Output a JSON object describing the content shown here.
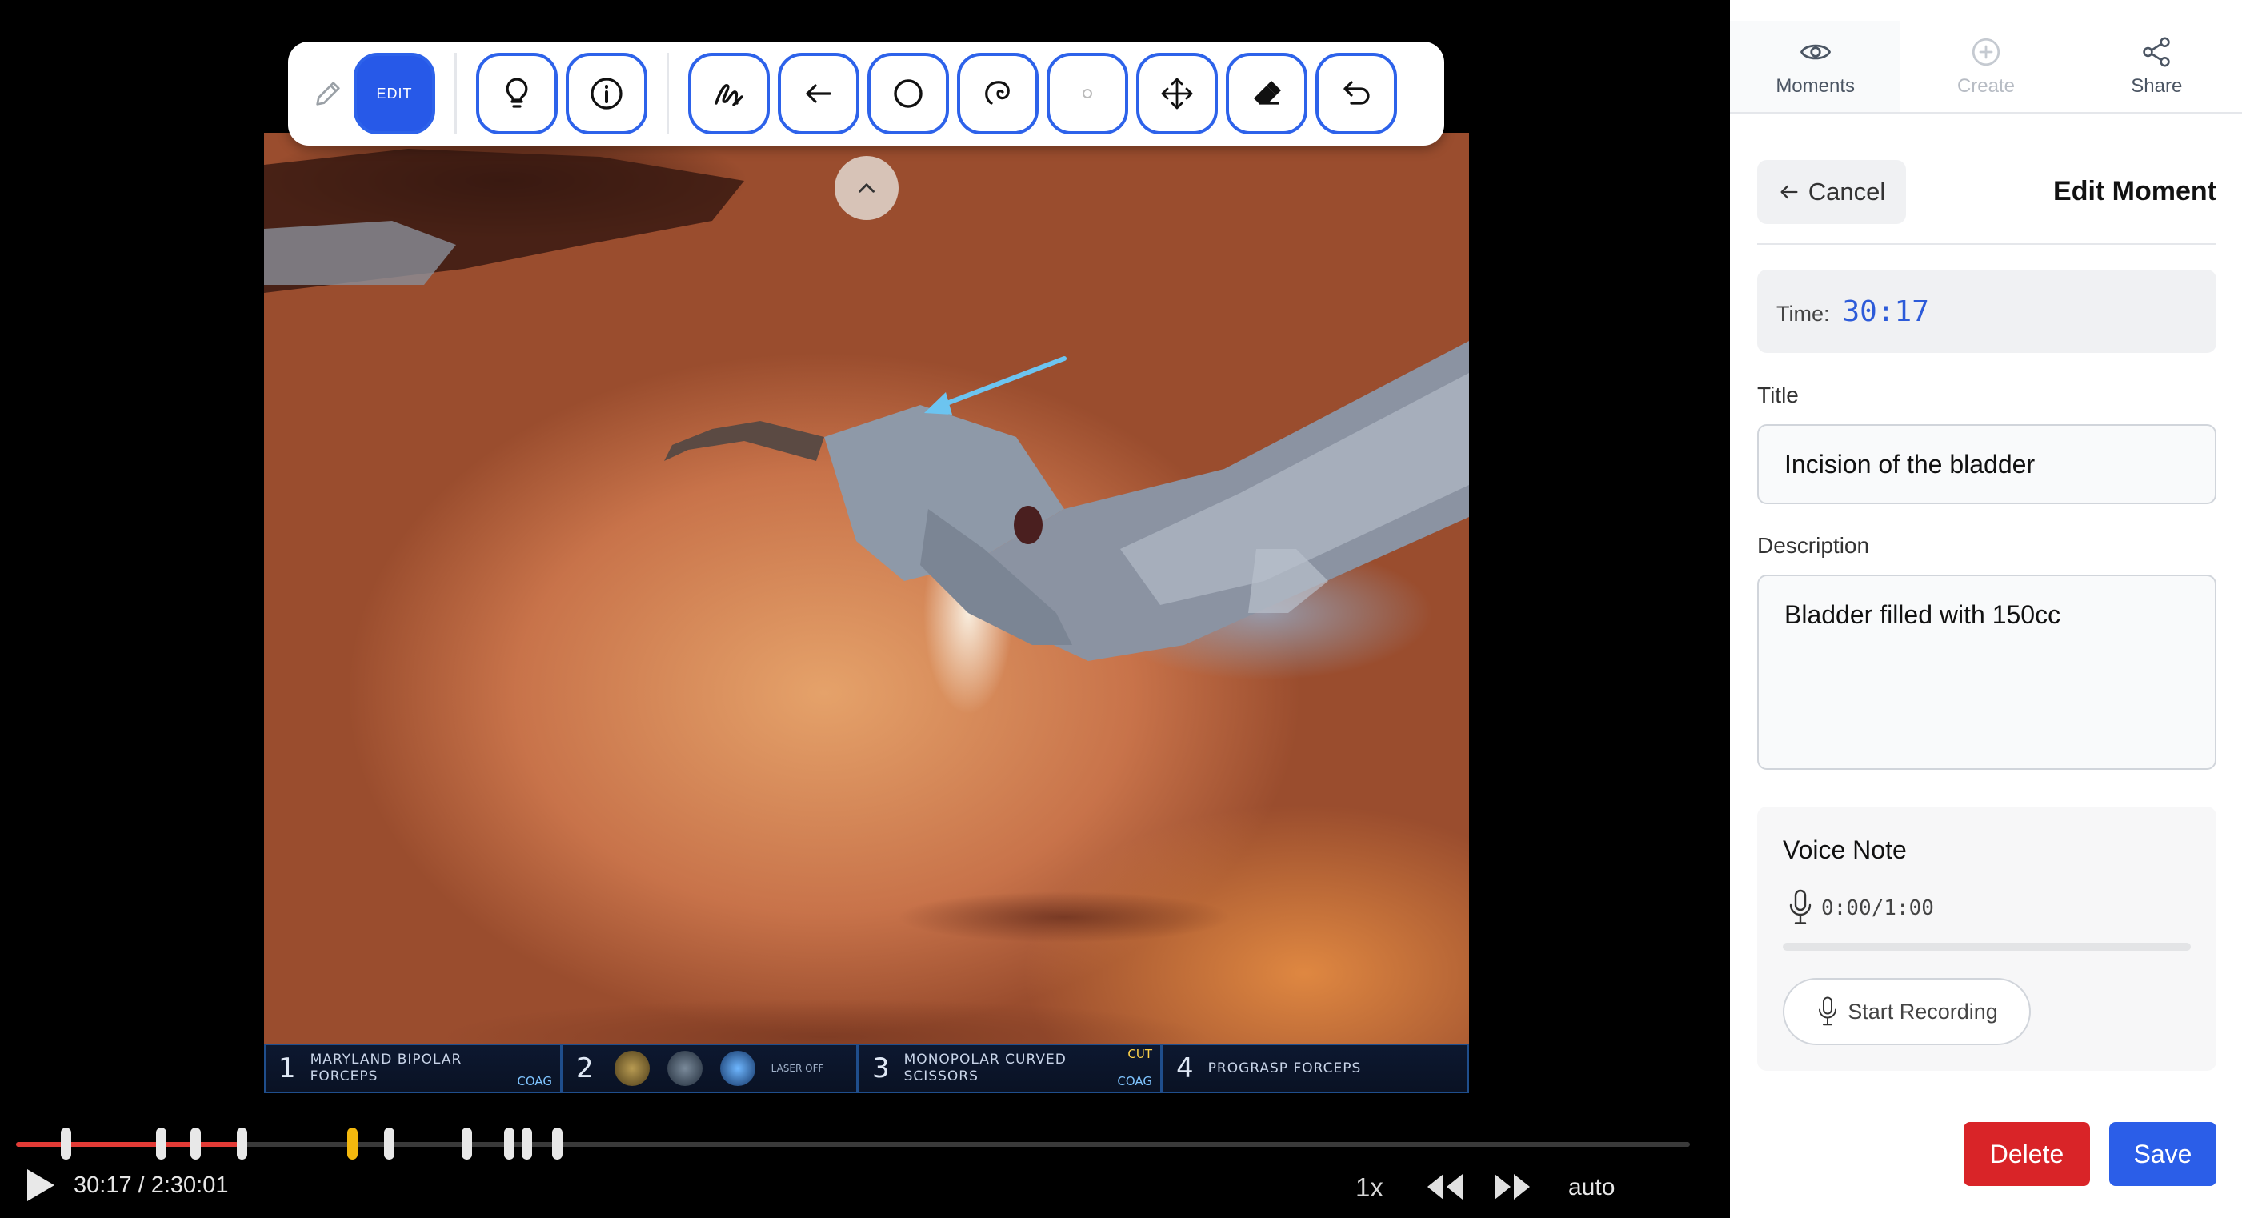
{
  "toolbar": {
    "edit_label": "EDIT",
    "tools": [
      "pencil-icon",
      "lightbulb-icon",
      "info-icon",
      "freehand-icon",
      "arrow-icon",
      "circle-icon",
      "lasso-icon",
      "dot-icon",
      "move-icon",
      "eraser-icon",
      "undo-icon"
    ]
  },
  "hud": {
    "instruments": [
      {
        "num": "1",
        "name": "MARYLAND BIPOLAR",
        "name2": "FORCEPS",
        "mode": "COAG"
      },
      {
        "num": "2",
        "small": "LASER OFF"
      },
      {
        "num": "3",
        "name": "MONOPOLAR CURVED",
        "name2": "SCISSORS",
        "mode_top": "CUT",
        "mode": "COAG"
      },
      {
        "num": "4",
        "name": "PROGRASP FORCEPS"
      }
    ]
  },
  "player": {
    "time_display": "30:17 / 2:30:01",
    "played_fraction": 0.1327,
    "speed": "1x",
    "quality": "auto",
    "markers": [
      0.0296,
      0.0864,
      0.1069,
      0.1347,
      0.2006,
      0.2228,
      0.2691,
      0.2945,
      0.305,
      0.3232
    ],
    "current_marker": 0.2006,
    "accent_color": "#e23b36",
    "marker_current_color": "#f3b80e"
  },
  "panel": {
    "tabs": [
      {
        "label": "Moments",
        "icon": "eye-icon",
        "state": "active"
      },
      {
        "label": "Create",
        "icon": "plus-circle-icon",
        "state": "disabled"
      },
      {
        "label": "Share",
        "icon": "share-icon",
        "state": "normal"
      }
    ],
    "cancel_label": "Cancel",
    "title": "Edit Moment",
    "time_label": "Time:",
    "time_value": "30:17",
    "title_field_label": "Title",
    "title_value": "Incision of the bladder",
    "description_label": "Description",
    "description_value": "Bladder filled with 150cc",
    "voice": {
      "title": "Voice Note",
      "time": "0:00/1:00",
      "progress": 0,
      "record_label": "Start Recording"
    },
    "delete_label": "Delete",
    "save_label": "Save",
    "primary_color": "#2b5ee8",
    "danger_color": "#d92428"
  }
}
